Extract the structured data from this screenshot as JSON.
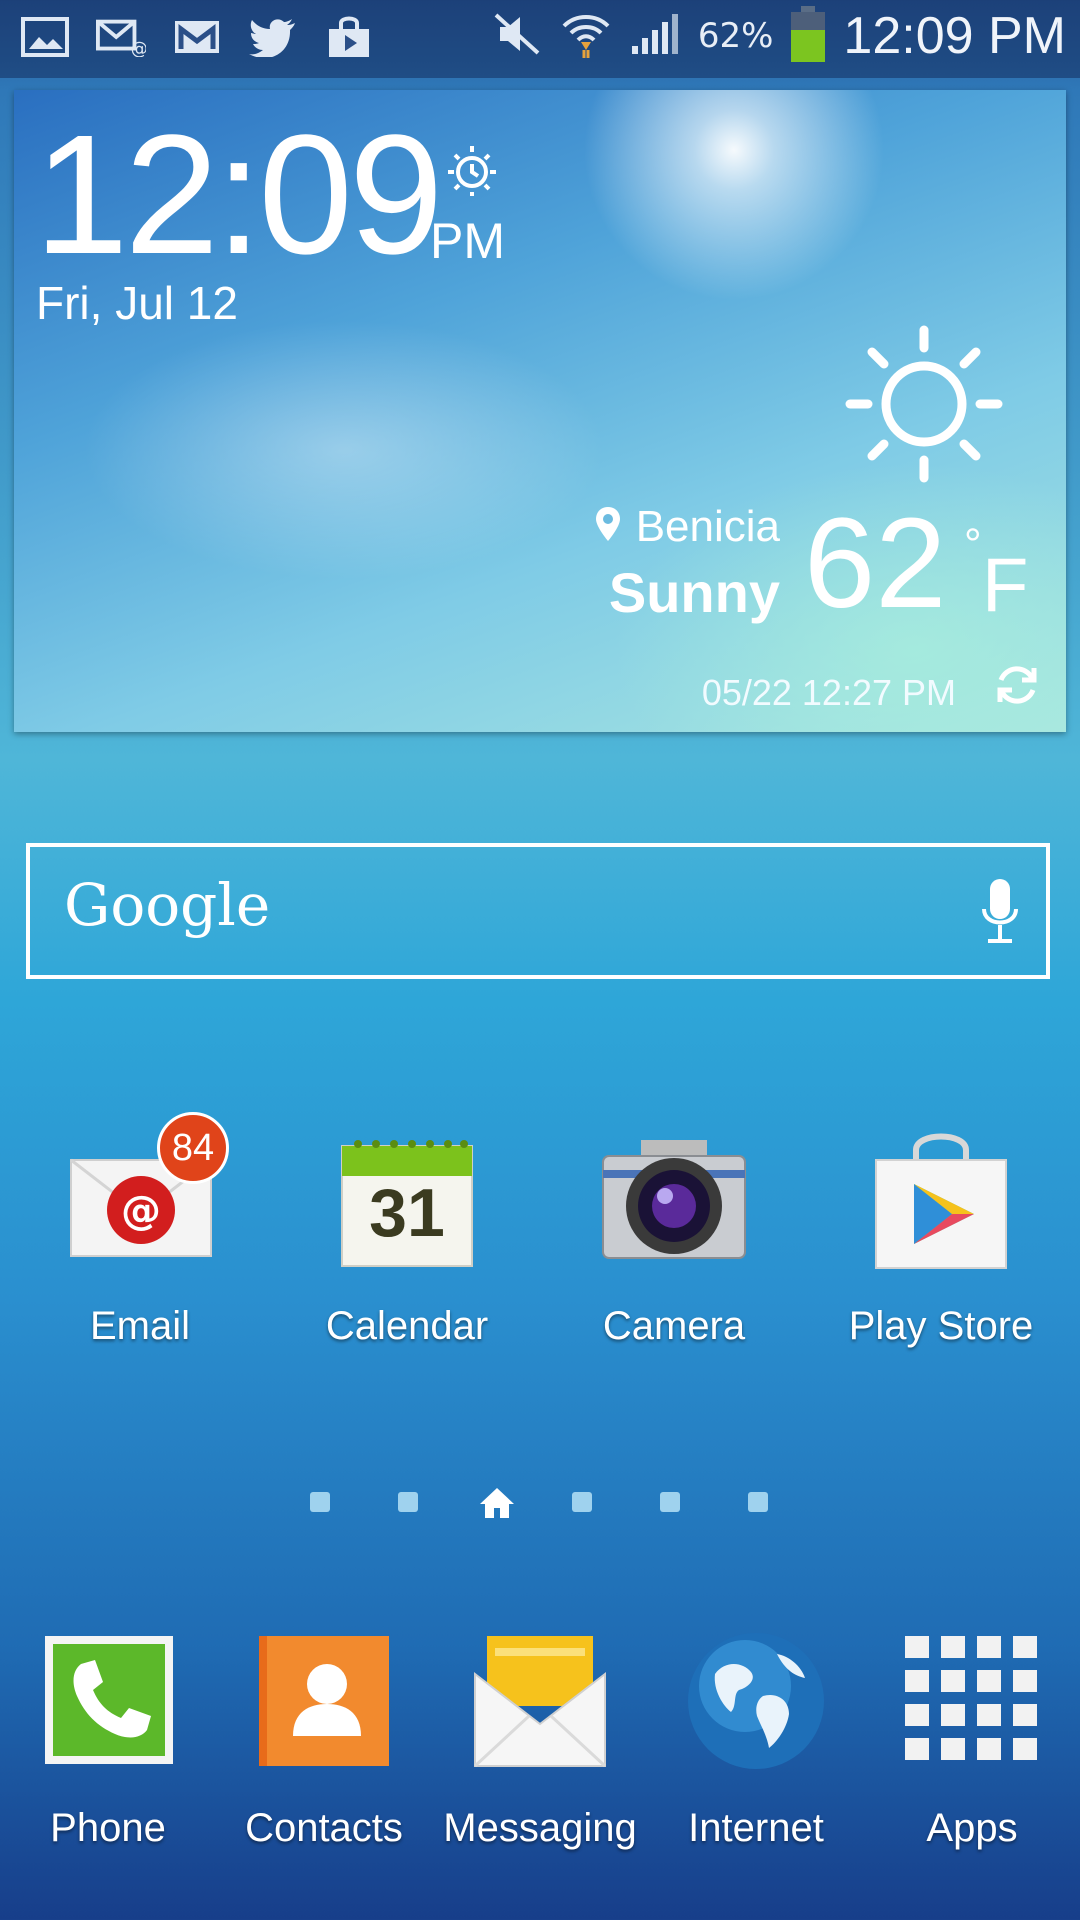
{
  "status_bar": {
    "left_icons": [
      "gallery-icon",
      "email-notification-icon",
      "gmail-icon",
      "twitter-icon",
      "shopping-bag-icon"
    ],
    "right_icons": [
      "mute-icon",
      "wifi-icon",
      "signal-icon",
      "battery-icon"
    ],
    "battery_percent": "62%",
    "time": "12:09 PM"
  },
  "weather_widget": {
    "time": "12:09",
    "ampm": "PM",
    "date": "Fri, Jul 12",
    "location": "Benicia",
    "condition": "Sunny",
    "temperature": "62",
    "degree_symbol": "°",
    "unit": "F",
    "updated": "05/22 12:27 PM"
  },
  "search_bar": {
    "logo_text": "Google"
  },
  "home_apps": [
    {
      "label": "Email",
      "badge": "84"
    },
    {
      "label": "Calendar",
      "day": "31"
    },
    {
      "label": "Camera"
    },
    {
      "label": "Play Store"
    }
  ],
  "page_indicator": {
    "pages": 6,
    "current": 3
  },
  "dock": [
    {
      "label": "Phone"
    },
    {
      "label": "Contacts"
    },
    {
      "label": "Messaging"
    },
    {
      "label": "Internet"
    },
    {
      "label": "Apps"
    }
  ],
  "colors": {
    "badge": "#e0441a",
    "phone_green": "#5cb82a",
    "contacts_orange": "#f07a20",
    "calendar_green": "#7cc21c",
    "messaging_yellow": "#f6c21c"
  }
}
